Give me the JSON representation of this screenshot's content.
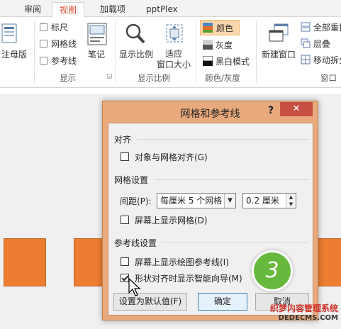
{
  "tabs": [
    {
      "label": "审阅",
      "active": false
    },
    {
      "label": "视图",
      "active": true
    },
    {
      "label": "加载项",
      "active": false
    },
    {
      "label": "pptPlex",
      "active": false
    }
  ],
  "ribbon": {
    "master_view": {
      "label": "注母版"
    },
    "show": {
      "ruler": {
        "label": "标尺",
        "checked": false
      },
      "gridlines": {
        "label": "网格线",
        "checked": false
      },
      "guides": {
        "label": "参考线",
        "checked": false
      },
      "notes_label": "笔记",
      "group_label": "显示"
    },
    "zoom": {
      "zoom_label": "显示比例",
      "fit_label_1": "适应",
      "fit_label_2": "窗口大小",
      "group_label": "显示比例"
    },
    "color": {
      "color_label": "颜色",
      "grayscale_label": "灰度",
      "bw_label": "黑白模式",
      "group_label": "颜色/灰度"
    },
    "window": {
      "new_window_label": "新建窗口",
      "arrange_all_label": "全部重排",
      "cascade_label": "层叠",
      "move_split_label": "移动拆分",
      "group_label": "窗口"
    }
  },
  "dialog": {
    "title": "网格和参考线",
    "help": "?",
    "close": "✕",
    "align_section": "对齐",
    "snap_label": "对象与网格对齐(G)",
    "snap_checked": false,
    "grid_section": "网格设置",
    "spacing_label": "间距(P):",
    "spacing_combo": "每厘米 5 个网格",
    "spacing_value": "0.2 厘米",
    "show_grid_label": "屏幕上显示网格(D)",
    "show_grid_checked": false,
    "guides_section": "参考线设置",
    "show_drawing_guides_label": "屏幕上显示绘图参考线(I)",
    "show_drawing_guides_checked": false,
    "smart_guides_label": "形状对齐时显示智能向导(M)",
    "smart_guides_checked": true,
    "set_default_button": "设置为默认值(F)",
    "ok_button": "确定",
    "cancel_button": "取消"
  },
  "step_badge": "3",
  "watermark": {
    "line1": "织梦内容管理系统",
    "line2": "DEDECMS.COM"
  },
  "colors": {
    "accent": "#d24726",
    "dialog_frame": "#e8a97c",
    "shape_fill": "#ed7d31",
    "badge": "#67b93e",
    "close_button": "#c74f44"
  }
}
